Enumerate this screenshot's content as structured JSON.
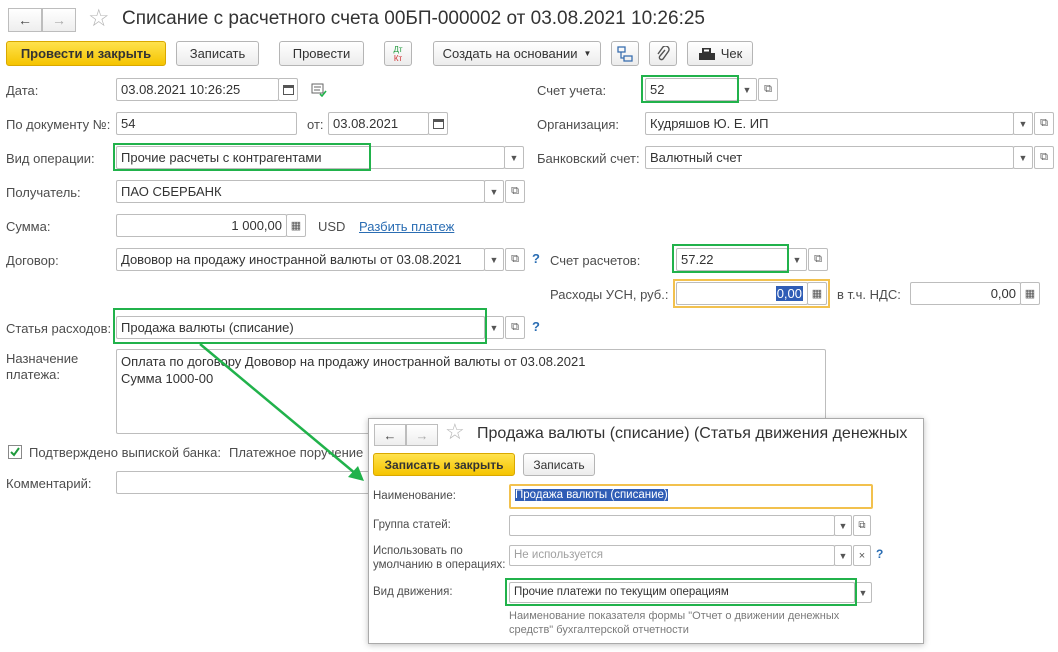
{
  "window": {
    "title": "Списание с расчетного счета 00БП-000002 от 03.08.2021 10:26:25"
  },
  "nav": {
    "back": "←",
    "forward": "→",
    "favorite": "☆"
  },
  "toolbar": {
    "post_close": "Провести и закрыть",
    "save": "Записать",
    "post": "Провести",
    "dtkt_top": "Дт",
    "dtkt_bottom": "Кт",
    "create_based": "Создать на основании",
    "check": "Чек"
  },
  "form": {
    "date_label": "Дата:",
    "date_value": "03.08.2021 10:26:25",
    "doc_no_label": "По документу №:",
    "doc_no_value": "54",
    "from_label": "от:",
    "from_value": "03.08.2021",
    "operation_label": "Вид операции:",
    "operation_value": "Прочие расчеты с контрагентами",
    "recipient_label": "Получатель:",
    "recipient_value": "ПАО СБЕРБАНК",
    "amount_label": "Сумма:",
    "amount_value": "1 000,00",
    "currency": "USD",
    "split_link": "Разбить платеж",
    "contract_label": "Договор:",
    "contract_value": "Дововор на продажу иностранной валюты от 03.08.2021",
    "expense_label": "Статья расходов:",
    "expense_value": "Продажа валюты (списание)",
    "purpose_label_1": "Назначение",
    "purpose_label_2": "платежа:",
    "purpose_line_1": "Оплата по договору Дововор на продажу иностранной валюты от 03.08.2021",
    "purpose_line_2": "Сумма 1000-00",
    "confirmed_label": "Подтверждено выпиской банка:",
    "payment_order": "Платежное поручение",
    "comment_label": "Комментарий:",
    "account_label": "Счет учета:",
    "account_value": "52",
    "org_label": "Организация:",
    "org_value": "Кудряшов Ю. Е. ИП",
    "bank_account_label": "Банковский счет:",
    "bank_account_value": "Валютный счет",
    "settlement_label": "Счет расчетов:",
    "settlement_value": "57.22",
    "usn_label": "Расходы УСН, руб.:",
    "usn_value": "0,00",
    "vat_label": "в т.ч. НДС:",
    "vat_value": "0,00",
    "help": "?"
  },
  "popup": {
    "title": "Продажа валюты (списание) (Статья движения денежных",
    "save_close": "Записать и закрыть",
    "save": "Записать",
    "name_label": "Наименование:",
    "name_value": "Продажа валюты (списание)",
    "group_label": "Группа статей:",
    "group_value": "",
    "default_label_1": "Использовать по",
    "default_label_2": "умолчанию в операциях:",
    "default_value": "Не используется",
    "movement_label": "Вид движения:",
    "movement_value": "Прочие платежи по текущим операциям",
    "hint_1": "Наименование показателя формы \"Отчет о движении денежных",
    "hint_2": "средств\" бухгалтерской отчетности",
    "help": "?"
  },
  "colors": {
    "highlight_green": "#21b24b",
    "highlight_orange": "#f2c14e",
    "primary_button": "#f5c400",
    "link": "#2a6db3"
  }
}
